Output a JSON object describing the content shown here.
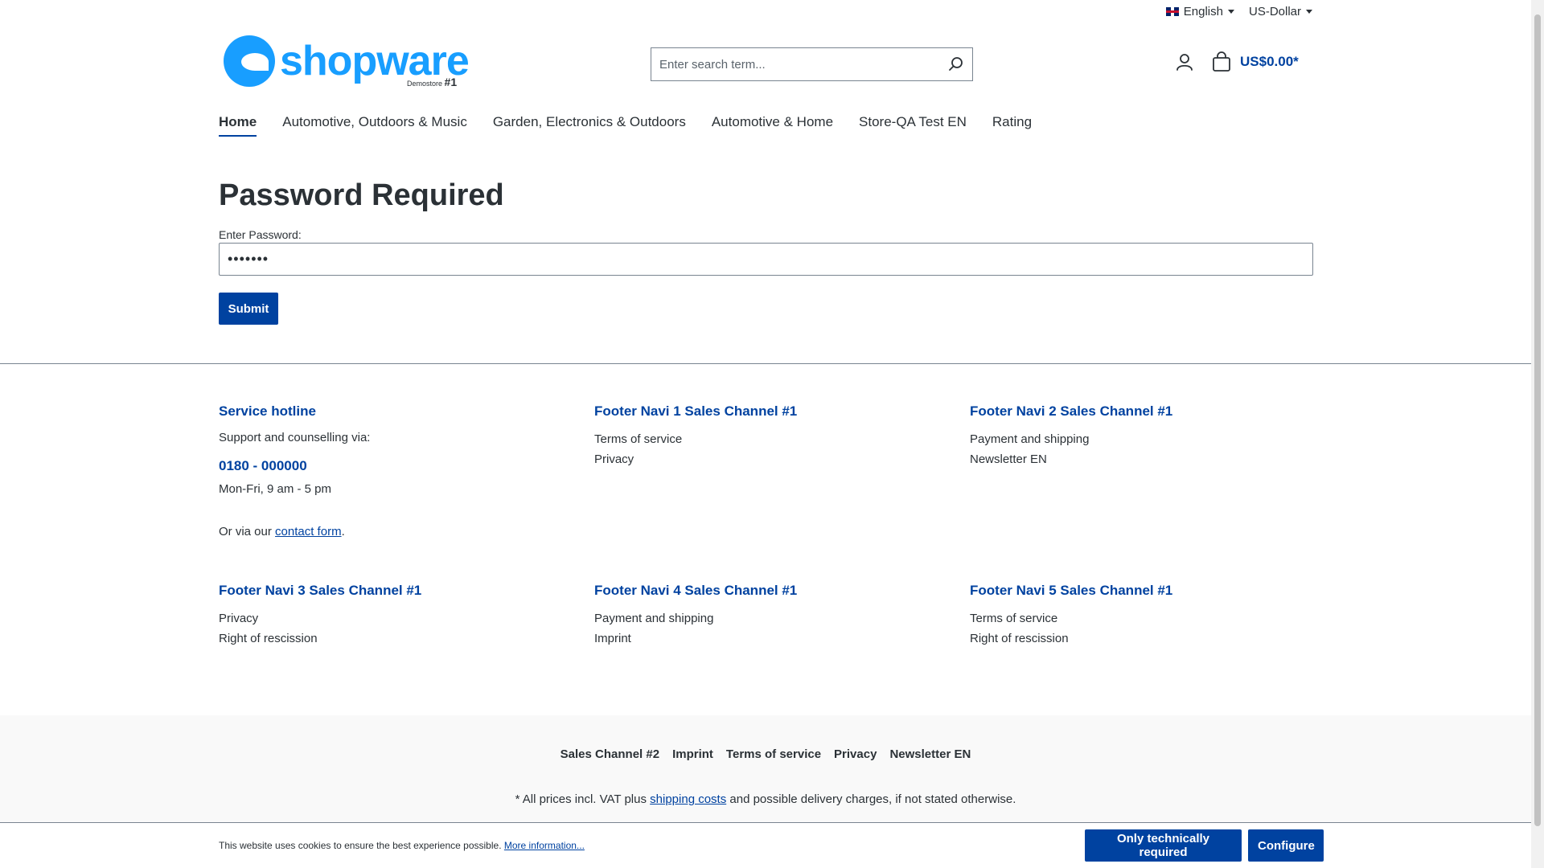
{
  "topbar": {
    "language": "English",
    "currency": "US-Dollar"
  },
  "header": {
    "logo_text": "shopware",
    "logo_sub": "Demostore",
    "logo_number": "#1",
    "search_placeholder": "Enter search term...",
    "cart_total": "US$0.00*"
  },
  "nav": {
    "items": [
      {
        "label": "Home"
      },
      {
        "label": "Automotive, Outdoors & Music"
      },
      {
        "label": "Garden, Electronics & Outdoors"
      },
      {
        "label": "Automotive & Home"
      },
      {
        "label": "Store-QA Test EN"
      },
      {
        "label": "Rating"
      }
    ]
  },
  "main": {
    "title": "Password Required",
    "password_label": "Enter Password:",
    "password_value": "•••••••",
    "submit_label": "Submit"
  },
  "footer": {
    "service": {
      "title": "Service hotline",
      "intro": "Support and counselling via:",
      "phone": "0180 - 000000",
      "hours": "Mon-Fri, 9 am - 5 pm",
      "contact_prefix": "Or via our ",
      "contact_link": "contact form",
      "contact_suffix": "."
    },
    "nav1": {
      "title": "Footer Navi 1 Sales Channel #1",
      "links": [
        "Terms of service",
        "Privacy"
      ]
    },
    "nav2": {
      "title": "Footer Navi 2 Sales Channel #1",
      "links": [
        "Payment and shipping",
        "Newsletter EN"
      ]
    },
    "nav3": {
      "title": "Footer Navi 3 Sales Channel #1",
      "links": [
        "Privacy",
        "Right of rescission"
      ]
    },
    "nav4": {
      "title": "Footer Navi 4 Sales Channel #1",
      "links": [
        "Payment and shipping",
        "Imprint"
      ]
    },
    "nav5": {
      "title": "Footer Navi 5 Sales Channel #1",
      "links": [
        "Terms of service",
        "Right of rescission"
      ]
    },
    "bottom_links": [
      "Sales Channel #2",
      "Imprint",
      "Terms of service",
      "Privacy",
      "Newsletter EN"
    ],
    "vat_prefix": "* All prices incl. VAT plus ",
    "vat_link": "shipping costs",
    "vat_suffix": " and possible delivery charges, if not stated otherwise."
  },
  "cookie": {
    "text": "This website uses cookies to ensure the best experience possible. ",
    "more_link": "More information...",
    "btn_required": "Only technically required",
    "btn_configure": "Configure"
  },
  "colors": {
    "brand": "#0042a0",
    "logo": "#189eff",
    "text": "#2b3136"
  }
}
